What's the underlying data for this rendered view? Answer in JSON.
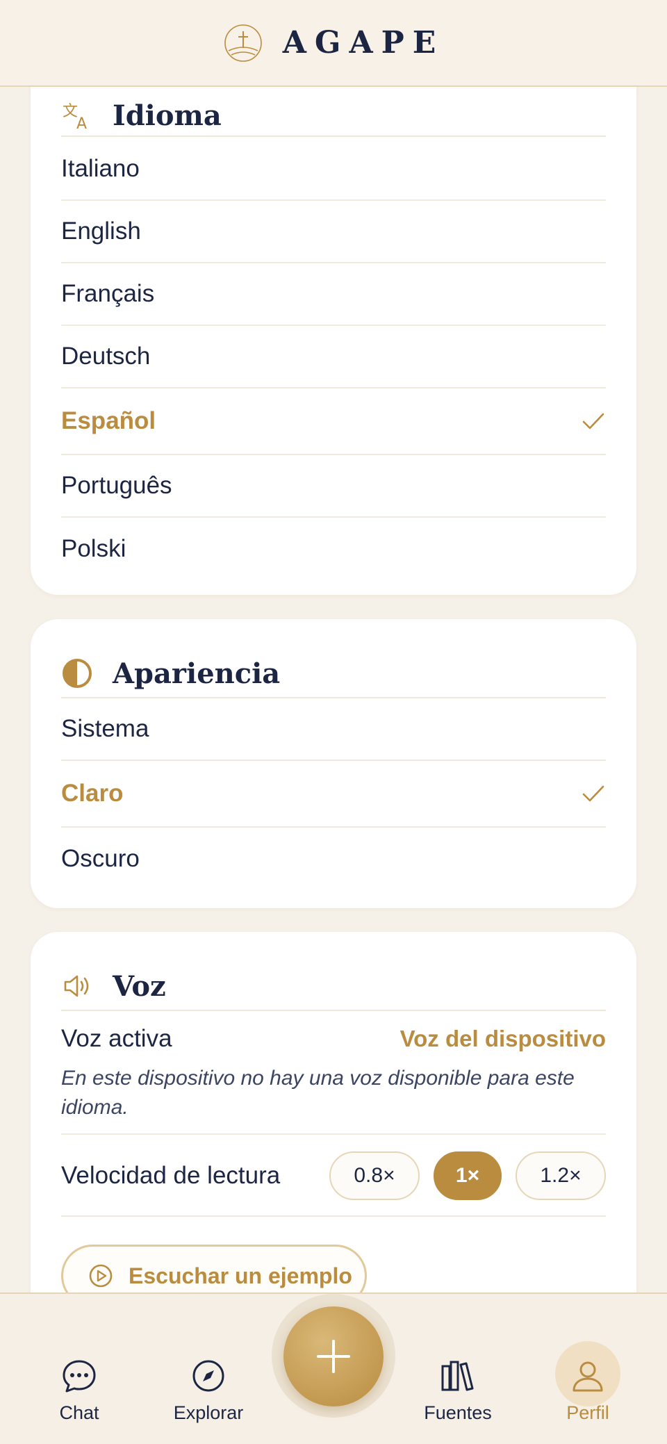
{
  "header": {
    "brand": "AGAPE"
  },
  "language": {
    "title": "Idioma",
    "options": [
      {
        "label": "Italiano",
        "selected": false
      },
      {
        "label": "English",
        "selected": false
      },
      {
        "label": "Français",
        "selected": false
      },
      {
        "label": "Deutsch",
        "selected": false
      },
      {
        "label": "Español",
        "selected": true
      },
      {
        "label": "Português",
        "selected": false
      },
      {
        "label": "Polski",
        "selected": false
      }
    ]
  },
  "appearance": {
    "title": "Apariencia",
    "options": [
      {
        "label": "Sistema",
        "selected": false
      },
      {
        "label": "Claro",
        "selected": true
      },
      {
        "label": "Oscuro",
        "selected": false
      }
    ]
  },
  "voice": {
    "title": "Voz",
    "active_label": "Voz activa",
    "active_value": "Voz del dispositivo",
    "note": "En este dispositivo no hay una voz disponible para este idioma.",
    "speed_label": "Velocidad de lectura",
    "speeds": [
      "0.8×",
      "1×",
      "1.2×"
    ],
    "selected_speed": "1×",
    "sample_button": "Escuchar un ejemplo"
  },
  "nav": {
    "chat": "Chat",
    "explore": "Explorar",
    "sources": "Fuentes",
    "profile": "Perfil",
    "active": "Perfil"
  },
  "colors": {
    "accent": "#b98c3f",
    "text": "#1c2642",
    "background": "#f5f0e8"
  }
}
